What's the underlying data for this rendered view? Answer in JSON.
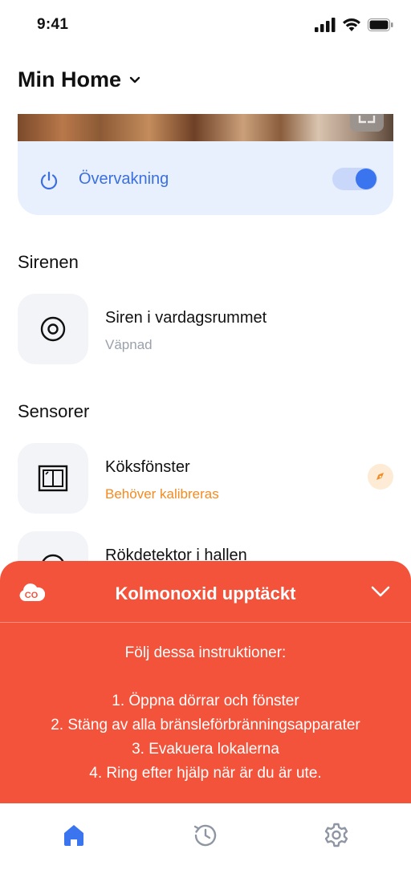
{
  "status_bar": {
    "time": "9:41"
  },
  "header": {
    "title": "Min Home",
    "dropdown_icon": "chevron-down-icon"
  },
  "camera": {
    "expand_icon": "expand-icon"
  },
  "monitoring": {
    "label": "Övervakning",
    "toggle_on": true,
    "icon": "power-icon"
  },
  "sections": {
    "siren": {
      "title": "Sirenen",
      "devices": [
        {
          "name": "Siren i vardagsrummet",
          "status": "Väpnad",
          "icon": "siren-icon"
        }
      ]
    },
    "sensors": {
      "title": "Sensorer",
      "devices": [
        {
          "name": "Köksfönster",
          "status": "Behöver kalibreras",
          "icon": "window-sensor-icon",
          "badge_icon": "compass-icon"
        },
        {
          "name": "Rökdetektor i hallen",
          "icon": "smoke-detector-icon"
        }
      ]
    }
  },
  "alert": {
    "icon_text": "CO",
    "title": "Kolmonoxid upptäckt",
    "intro": "Följ dessa instruktioner:",
    "steps": [
      "1. Öppna dörrar och fönster",
      "2. Stäng av alla bränsleförbränningsapparater",
      "3. Evakuera lokalerna",
      "4. Ring efter hjälp när är du är ute."
    ]
  },
  "tabs": [
    {
      "id": "home",
      "icon": "home-icon",
      "active": true
    },
    {
      "id": "history",
      "icon": "history-icon",
      "active": false
    },
    {
      "id": "settings",
      "icon": "gear-icon",
      "active": false
    }
  ],
  "colors": {
    "accent": "#3a74ef",
    "alert": "#f4533b",
    "warning": "#f58a1f"
  }
}
